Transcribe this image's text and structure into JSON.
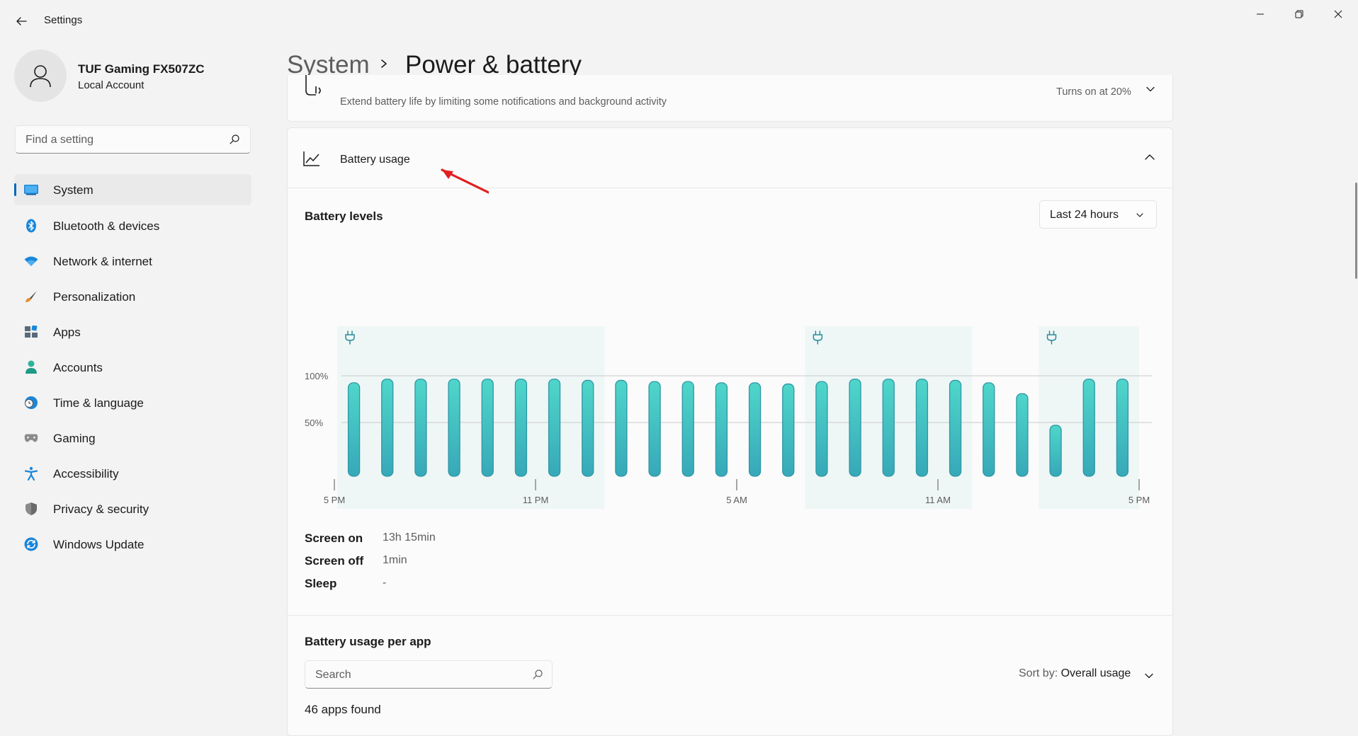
{
  "window": {
    "title": "Settings",
    "back_icon": "back-arrow-icon",
    "controls": [
      "minimize-icon",
      "maximize-icon",
      "close-icon"
    ]
  },
  "profile": {
    "name": "TUF Gaming FX507ZC",
    "account_type": "Local Account",
    "avatar_icon": "person-icon"
  },
  "search": {
    "placeholder": "Find a setting",
    "value": ""
  },
  "sidebar": {
    "items": [
      {
        "label": "System",
        "icon": "system-icon",
        "active": true
      },
      {
        "label": "Bluetooth & devices",
        "icon": "bluetooth-icon"
      },
      {
        "label": "Network & internet",
        "icon": "wifi-icon"
      },
      {
        "label": "Personalization",
        "icon": "brush-icon"
      },
      {
        "label": "Apps",
        "icon": "apps-icon"
      },
      {
        "label": "Accounts",
        "icon": "accounts-icon"
      },
      {
        "label": "Time & language",
        "icon": "clock-globe-icon"
      },
      {
        "label": "Gaming",
        "icon": "gamepad-icon"
      },
      {
        "label": "Accessibility",
        "icon": "accessibility-icon"
      },
      {
        "label": "Privacy & security",
        "icon": "shield-icon"
      },
      {
        "label": "Windows Update",
        "icon": "update-icon"
      }
    ]
  },
  "breadcrumb": {
    "parent": "System",
    "current": "Power & battery"
  },
  "battery_saver": {
    "description": "Extend battery life by limiting some notifications and background activity",
    "status": "Turns on at 20%"
  },
  "battery_usage": {
    "title": "Battery usage",
    "levels_title": "Battery levels",
    "range": "Last 24 hours",
    "stats": [
      {
        "label": "Screen on",
        "value": "13h 15min"
      },
      {
        "label": "Screen off",
        "value": "1min"
      },
      {
        "label": "Sleep",
        "value": "-"
      }
    ],
    "per_app": {
      "title": "Battery usage per app",
      "search_placeholder": "Search",
      "sort_prefix": "Sort by:",
      "sort_value": "Overall usage",
      "apps_found": "46 apps found"
    }
  },
  "colors": {
    "accent": "#0067c0",
    "bar_top": "#4fd6ca",
    "bar_bottom": "#37a8b8",
    "charging_band": "#eef7f6",
    "annotation": "#e02020"
  },
  "chart_data": {
    "type": "bar",
    "x_ticks": [
      "5 PM",
      "11 PM",
      "5 AM",
      "11 AM",
      "5 PM"
    ],
    "y_ticks": [
      "100%",
      "50%"
    ],
    "ylim": [
      0,
      100
    ],
    "values": [
      77,
      80,
      80,
      80,
      80,
      80,
      80,
      79,
      79,
      78,
      78,
      77,
      77,
      76,
      78,
      80,
      80,
      80,
      79,
      77,
      68,
      42,
      80,
      80
    ],
    "charging_periods": [
      [
        0,
        7
      ],
      [
        14,
        18
      ],
      [
        21,
        23
      ]
    ],
    "charging_icon": "plug-icon",
    "grid": true
  }
}
